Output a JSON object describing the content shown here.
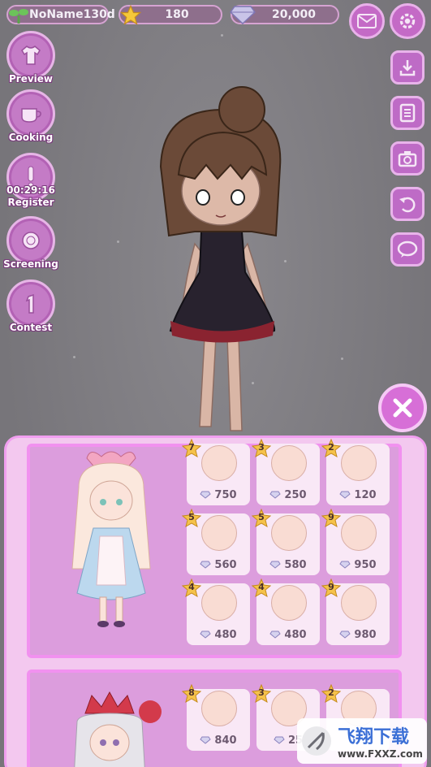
{
  "top_bar": {
    "player_name": "NoName130d",
    "stars": "180",
    "diamonds": "20,000"
  },
  "left_menu": [
    {
      "label": "Preview",
      "icon": "shirt-icon"
    },
    {
      "label": "Cooking",
      "icon": "cup-icon"
    },
    {
      "label": "Register",
      "timer": "00:29:16",
      "icon": "exclamation-icon"
    },
    {
      "label": "Screening",
      "icon": "medal-icon"
    },
    {
      "label": "Contest",
      "icon": "number-one-icon"
    }
  ],
  "right_menu": [
    "download-icon",
    "notes-icon",
    "camera-icon",
    "undo-icon",
    "chat-icon"
  ],
  "set1": {
    "tiles": [
      {
        "level": "7",
        "price": "750"
      },
      {
        "level": "3",
        "price": "250"
      },
      {
        "level": "2",
        "price": "120"
      },
      {
        "level": "5",
        "price": "560"
      },
      {
        "level": "5",
        "price": "580"
      },
      {
        "level": "9",
        "price": "950"
      },
      {
        "level": "4",
        "price": "480"
      },
      {
        "level": "4",
        "price": "480"
      },
      {
        "level": "9",
        "price": "980"
      }
    ]
  },
  "set2": {
    "tiles": [
      {
        "level": "8",
        "price": "840"
      },
      {
        "level": "3",
        "price": "25"
      },
      {
        "level": "2",
        "price": ""
      }
    ]
  },
  "watermark": {
    "title": "飞翔下载",
    "url": "www.FXXZ.com"
  },
  "colors": {
    "panel": "#f3c8ef",
    "card": "#dc9ddd",
    "accent": "#c46ac6"
  }
}
